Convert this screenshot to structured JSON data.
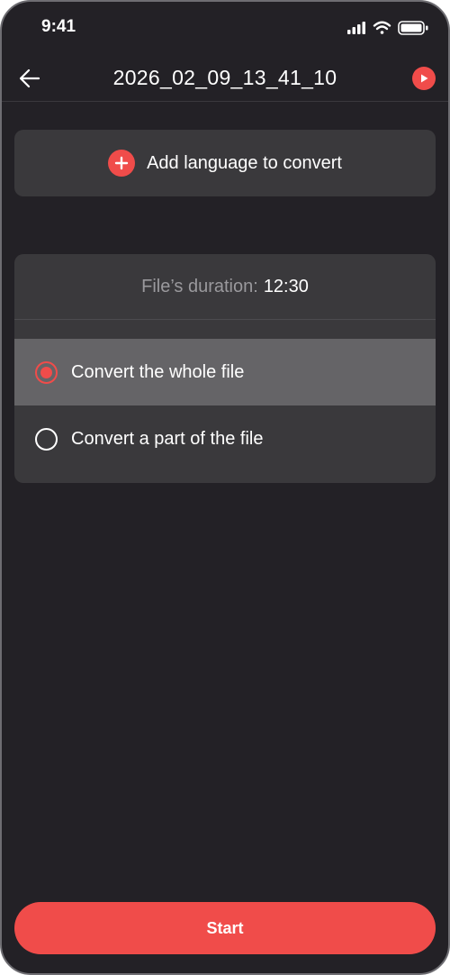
{
  "status_bar": {
    "time": "9:41",
    "icons": [
      "signal-icon",
      "wifi-icon",
      "battery-icon"
    ]
  },
  "header": {
    "title": "2026_02_09_13_41_10",
    "back_icon": "arrow-left-icon",
    "play_icon": "play-icon"
  },
  "add_language": {
    "label": "Add language to convert",
    "icon": "plus-icon"
  },
  "duration": {
    "label": "File’s duration:",
    "value": "12:30"
  },
  "options": [
    {
      "label": "Convert the whole file",
      "selected": true
    },
    {
      "label": "Convert a part of the file",
      "selected": false
    }
  ],
  "start_button": {
    "label": "Start"
  },
  "colors": {
    "accent": "#f04c4a",
    "background": "#232126",
    "card": "#3a393c",
    "selected_row": "#656467"
  }
}
